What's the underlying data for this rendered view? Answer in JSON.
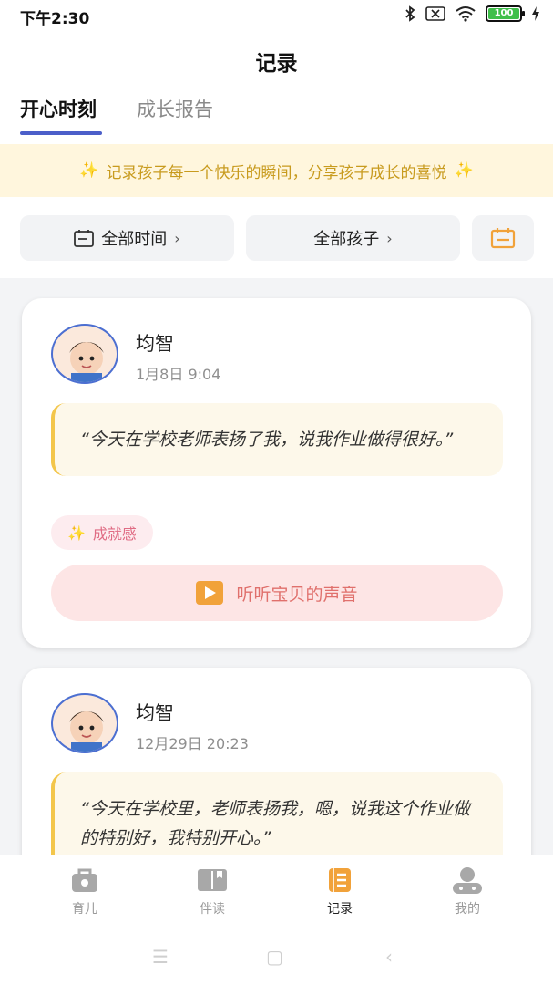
{
  "status": {
    "time": "下午2:30",
    "battery": "100"
  },
  "header": {
    "title": "记录"
  },
  "tabs": [
    {
      "label": "开心时刻"
    },
    {
      "label": "成长报告"
    }
  ],
  "banner": {
    "text": "记录孩子每一个快乐的瞬间，分享孩子成长的喜悦"
  },
  "filters": {
    "time": "全部时间",
    "kids": "全部孩子"
  },
  "records": [
    {
      "name": "均智",
      "date": "1月8日 9:04",
      "quote": "“今天在学校老师表扬了我，说我作业做得很好。”",
      "tag": "成就感",
      "listen": "听听宝贝的声音"
    },
    {
      "name": "均智",
      "date": "12月29日 20:23",
      "quote": "“今天在学校里，老师表扬我，嗯，说我这个作业做的特别好，我特别开心。”"
    }
  ],
  "bottom_nav": [
    {
      "label": "育儿",
      "icon": "bag-icon"
    },
    {
      "label": "伴读",
      "icon": "book-icon"
    },
    {
      "label": "记录",
      "icon": "notes-icon"
    },
    {
      "label": "我的",
      "icon": "user-icon"
    }
  ],
  "colors": {
    "accent": "#4c5fc9",
    "banner_bg": "#fff6dd",
    "active_nav": "#f1a23a"
  }
}
